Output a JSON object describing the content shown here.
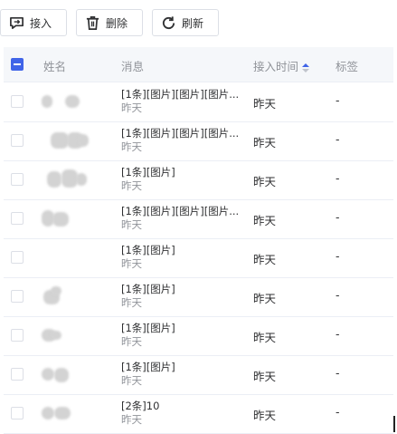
{
  "toolbar": {
    "accept_label": "接入",
    "delete_label": "删除",
    "refresh_label": "刷新"
  },
  "table": {
    "headers": {
      "name": "姓名",
      "message": "消息",
      "access_time": "接入时间",
      "tag": "标签"
    },
    "select_all_checked": true,
    "rows": [
      {
        "message": "[1条][图片][图片][图片...",
        "message_time": "昨天",
        "access_time": "昨天",
        "tag": "-"
      },
      {
        "message": "[1条][图片][图片][图片...",
        "message_time": "昨天",
        "access_time": "昨天",
        "tag": "-"
      },
      {
        "message": "[1条][图片]",
        "message_time": "昨天",
        "access_time": "昨天",
        "tag": "-"
      },
      {
        "message": "[1条][图片][图片][图片...",
        "message_time": "昨天",
        "access_time": "昨天",
        "tag": "-"
      },
      {
        "message": "[1条][图片]",
        "message_time": "昨天",
        "access_time": "昨天",
        "tag": "-"
      },
      {
        "message": "[1条][图片]",
        "message_time": "昨天",
        "access_time": "昨天",
        "tag": "-"
      },
      {
        "message": "[1条][图片]",
        "message_time": "昨天",
        "access_time": "昨天",
        "tag": "-"
      },
      {
        "message": "[1条][图片]",
        "message_time": "昨天",
        "access_time": "昨天",
        "tag": "-"
      },
      {
        "message": "[2条]10",
        "message_time": "昨天",
        "access_time": "昨天",
        "tag": "-"
      }
    ]
  },
  "colors": {
    "accent": "#4064e8",
    "header_bg": "#f5f7fa",
    "border": "#ebeef5"
  }
}
